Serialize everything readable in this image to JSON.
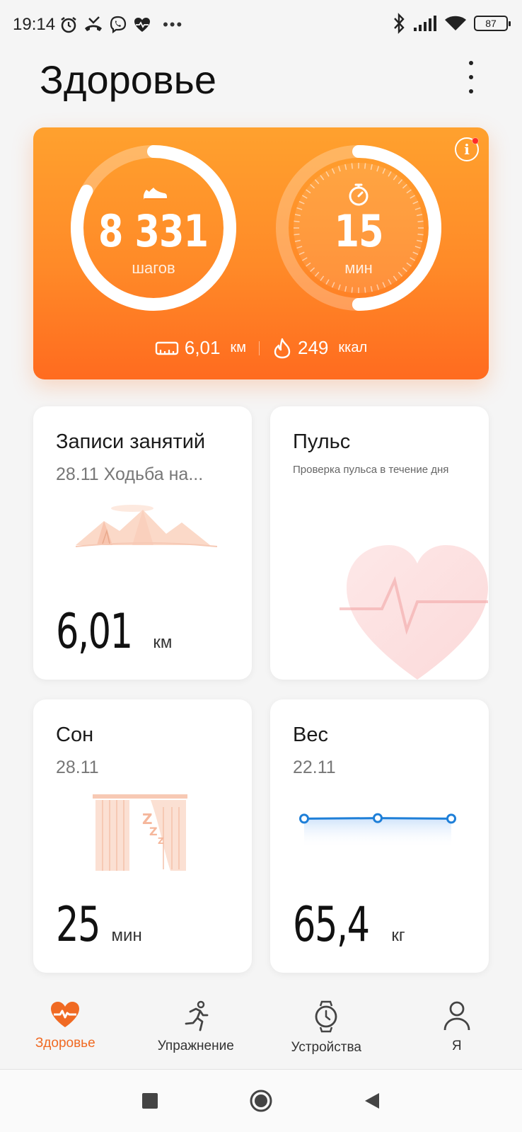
{
  "status_bar": {
    "time": "19:14",
    "battery": "87",
    "icons": [
      "alarm-icon",
      "missed-call-icon",
      "viber-icon",
      "health-icon",
      "bluetooth-icon",
      "signal-icon",
      "wifi-icon"
    ]
  },
  "header": {
    "title": "Здоровье"
  },
  "activity": {
    "steps_value": "8 331",
    "steps_unit": "шагов",
    "steps_progress": 0.83,
    "minutes_value": "15",
    "minutes_unit": "мин",
    "minutes_progress": 0.5,
    "distance_value": "6,01",
    "distance_unit": "км",
    "calories_value": "249",
    "calories_unit": "ккал"
  },
  "tiles": {
    "workouts": {
      "title": "Записи занятий",
      "subtitle": "28.11 Ходьба на...",
      "value": "6,01",
      "unit": "км"
    },
    "pulse": {
      "title": "Пульс",
      "note": "Проверка пульса в течение дня"
    },
    "sleep": {
      "title": "Сон",
      "subtitle": "28.11",
      "value": "25",
      "unit": "мин"
    },
    "weight": {
      "title": "Вес",
      "subtitle": "22.11",
      "value": "65,4",
      "unit": "кг",
      "trend": [
        65.3,
        65.4,
        65.3
      ]
    }
  },
  "nav": {
    "items": [
      {
        "label": "Здоровье",
        "icon": "heart-pulse-icon",
        "active": true
      },
      {
        "label": "Упражнение",
        "icon": "running-icon",
        "active": false
      },
      {
        "label": "Устройства",
        "icon": "watch-icon",
        "active": false
      },
      {
        "label": "Я",
        "icon": "person-icon",
        "active": false
      }
    ]
  },
  "colors": {
    "accent": "#f06a23",
    "card_top": "#ffa12e",
    "card_bottom": "#ff6b1f",
    "weight_line": "#1e7fd8"
  }
}
